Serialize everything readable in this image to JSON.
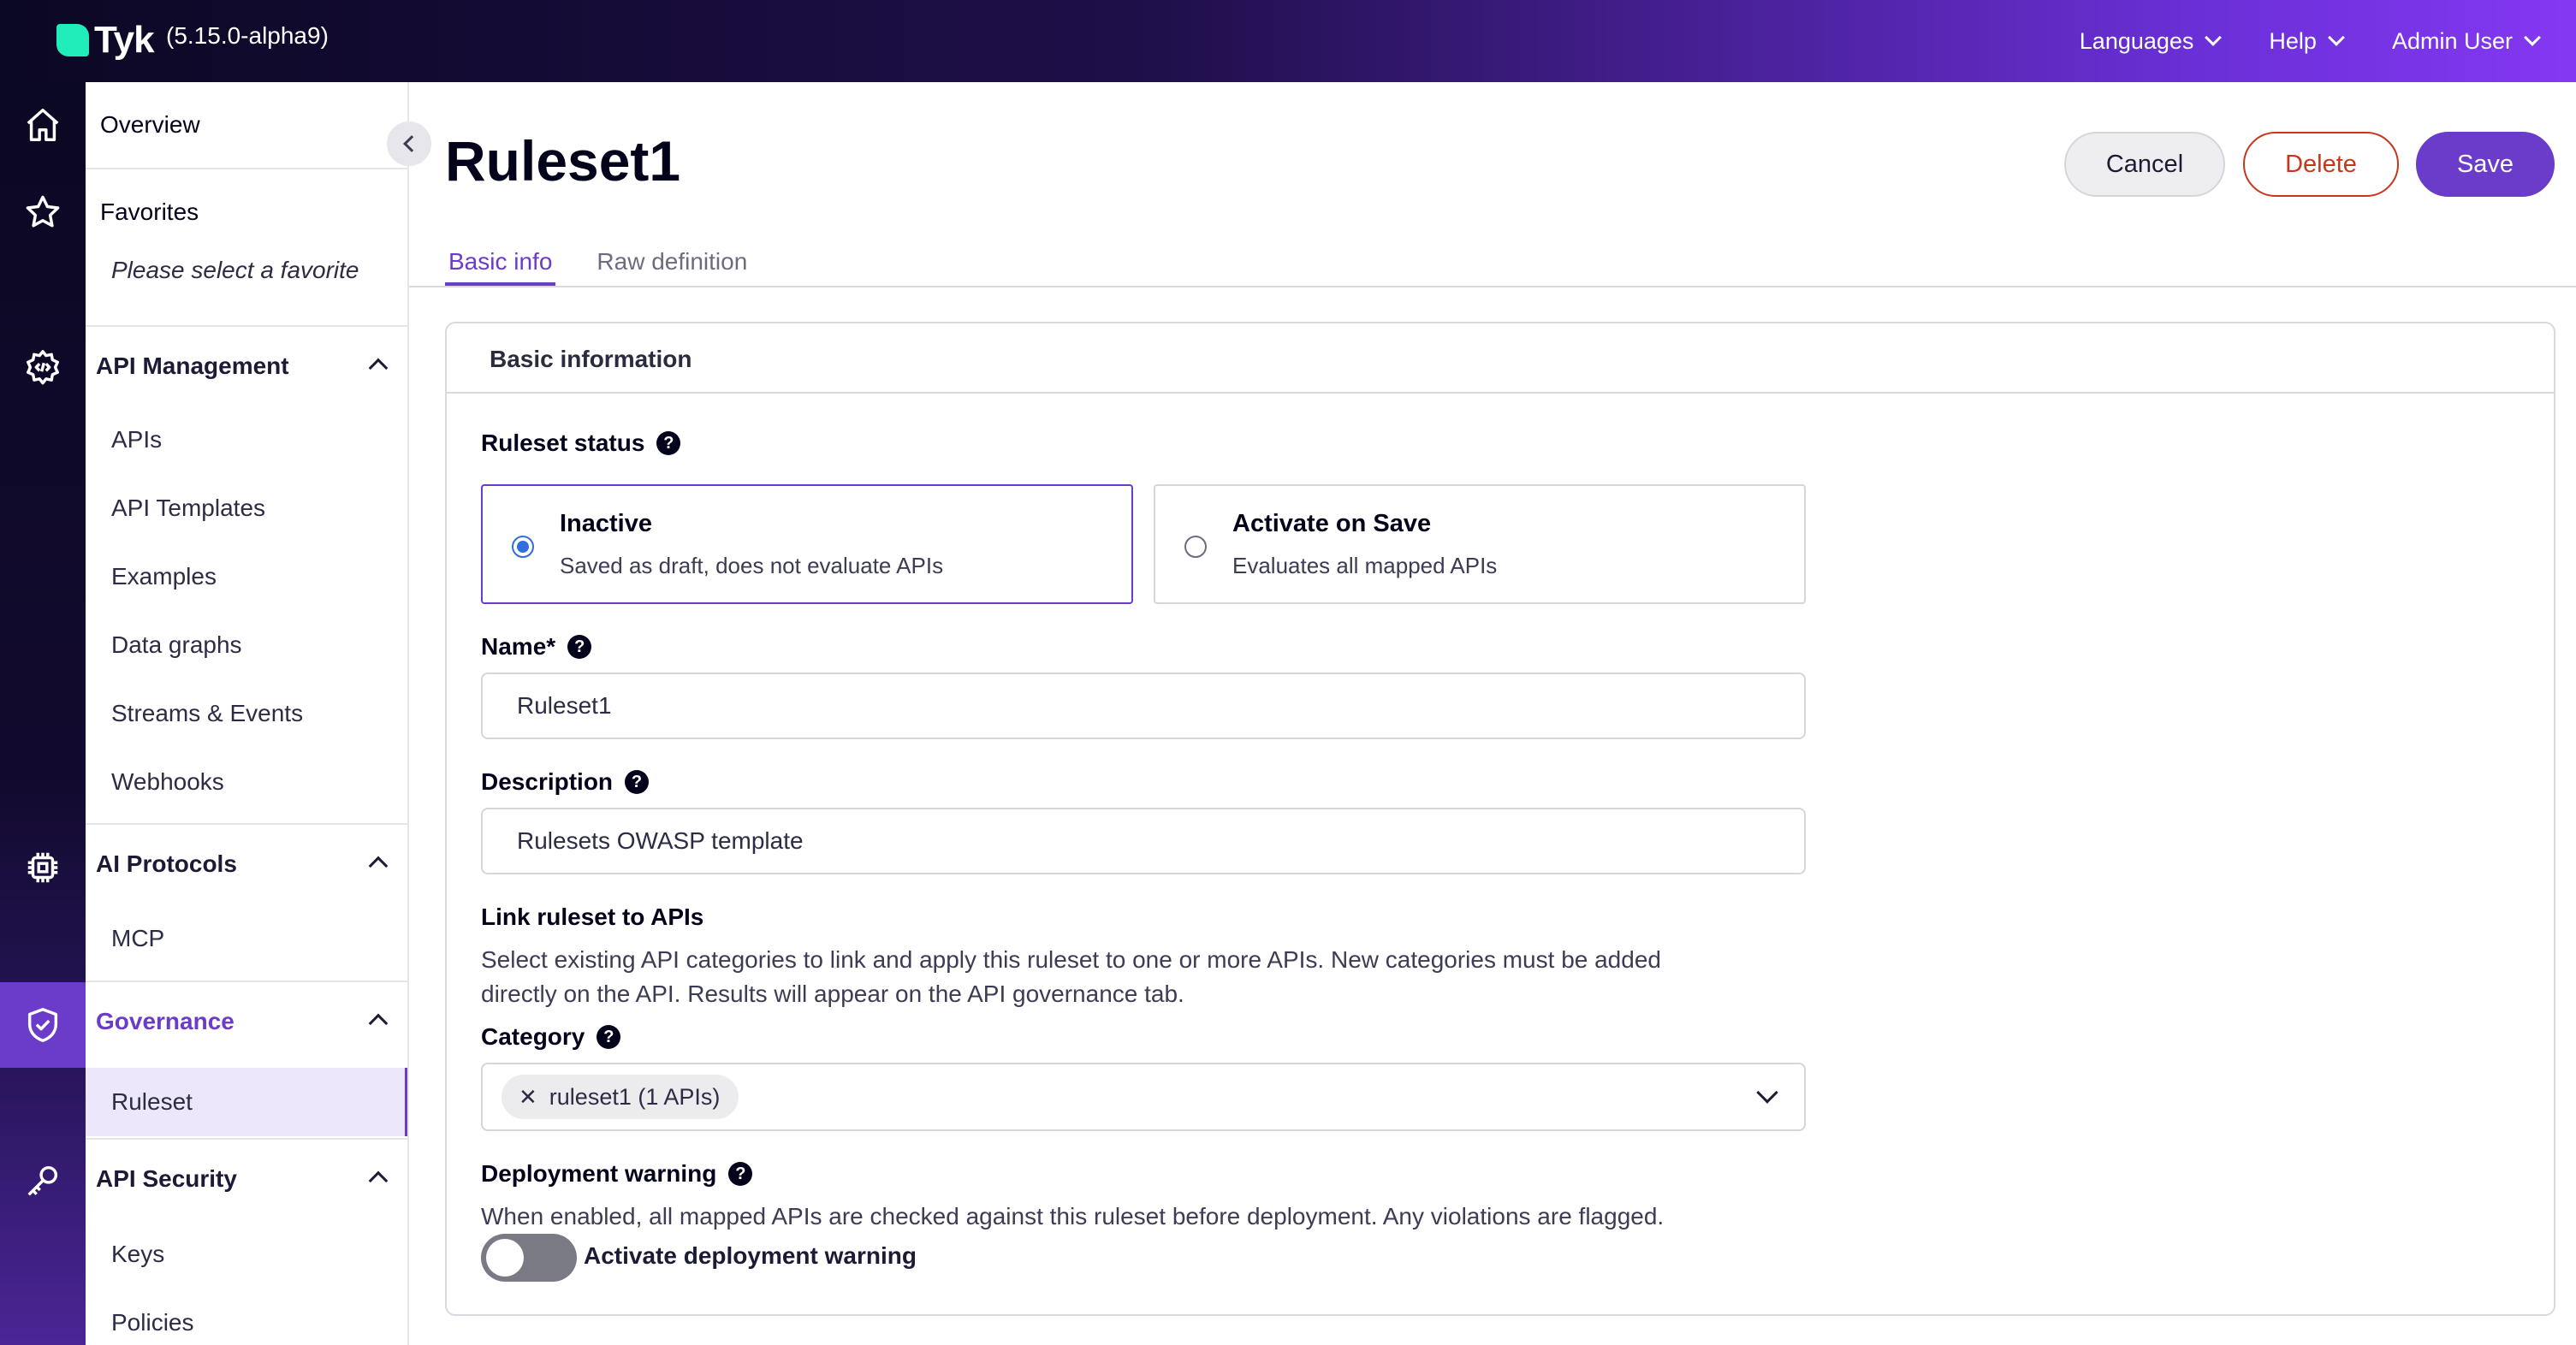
{
  "app": {
    "brand": "Tyk",
    "version": "(5.15.0-alpha9)"
  },
  "topnav": {
    "languages": "Languages",
    "help": "Help",
    "user": "Admin User"
  },
  "sidebar": {
    "overview": "Overview",
    "favorites": "Favorites",
    "favorites_empty": "Please select a favorite",
    "api_management": {
      "title": "API Management",
      "items": [
        "APIs",
        "API Templates",
        "Examples",
        "Data graphs",
        "Streams & Events",
        "Webhooks"
      ]
    },
    "ai_protocols": {
      "title": "AI Protocols",
      "items": [
        "MCP"
      ]
    },
    "governance": {
      "title": "Governance",
      "items": [
        "Ruleset"
      ]
    },
    "api_security": {
      "title": "API Security",
      "items": [
        "Keys",
        "Policies"
      ]
    }
  },
  "page": {
    "title": "Ruleset1",
    "buttons": {
      "cancel": "Cancel",
      "delete": "Delete",
      "save": "Save"
    },
    "tabs": [
      "Basic info",
      "Raw definition"
    ],
    "active_tab": "Basic info"
  },
  "form": {
    "section_title": "Basic information",
    "status": {
      "label": "Ruleset status",
      "options": [
        {
          "title": "Inactive",
          "sub": "Saved as draft, does not evaluate APIs",
          "selected": true
        },
        {
          "title": "Activate on Save",
          "sub": "Evaluates all mapped APIs",
          "selected": false
        }
      ]
    },
    "name": {
      "label": "Name*",
      "value": "Ruleset1"
    },
    "description": {
      "label": "Description",
      "value": "Rulesets OWASP template"
    },
    "link": {
      "label": "Link ruleset to APIs",
      "help_line1": "Select existing API categories to link and apply this ruleset to one or more APIs. New categories must be added",
      "help_line2": "directly on the API. Results will appear on the API governance tab."
    },
    "category": {
      "label": "Category",
      "chip_remove": "✕",
      "chip": "ruleset1 (1 APIs)"
    },
    "deployment_warning": {
      "label": "Deployment warning",
      "help": "When enabled, all mapped APIs are checked against this ruleset before deployment. Any violations are flagged.",
      "toggle_label": "Activate deployment warning",
      "enabled": false
    },
    "help_glyph": "?"
  },
  "colors": {
    "accent": "#6b3cc9",
    "danger": "#c8371b",
    "radio": "#2f6fdb",
    "brand_mark": "#20edba"
  },
  "icons": [
    "home-icon",
    "star-icon",
    "gear-code-icon",
    "chip-icon",
    "shield-check-icon",
    "key-icon",
    "chevron-down-icon",
    "chevron-up-icon",
    "chevron-left-icon",
    "help-icon",
    "close-icon"
  ]
}
